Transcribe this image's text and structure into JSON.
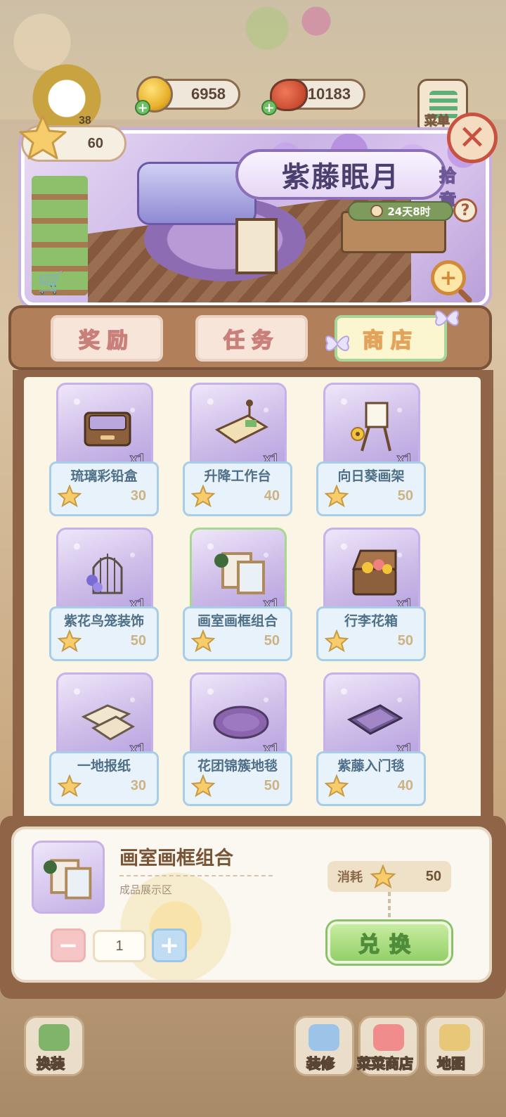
{
  "currency": {
    "coins": "6958",
    "food": "10183",
    "level": "38",
    "menu_label": "菜单"
  },
  "event": {
    "star_count": "60",
    "title": "紫藤眠月",
    "badge": "拾章",
    "timer": "24天8时",
    "help": "?",
    "zoom": "+"
  },
  "tabs": [
    {
      "label": "奖励",
      "active": false
    },
    {
      "label": "任务",
      "active": false
    },
    {
      "label": "商店",
      "active": true
    }
  ],
  "shop_items": [
    {
      "name": "琉璃彩铅盒",
      "qty": "x1",
      "price": "30",
      "icon": "pencil-box-icon"
    },
    {
      "name": "升降工作台",
      "qty": "x1",
      "price": "40",
      "icon": "workbench-icon"
    },
    {
      "name": "向日葵画架",
      "qty": "x1",
      "price": "50",
      "icon": "sunflower-easel-icon"
    },
    {
      "name": "紫花鸟笼装饰",
      "qty": "x1",
      "price": "50",
      "icon": "birdcage-icon"
    },
    {
      "name": "画室画框组合",
      "qty": "x1",
      "price": "50",
      "icon": "picture-frames-icon"
    },
    {
      "name": "行李花箱",
      "qty": "x1",
      "price": "50",
      "icon": "flower-trunk-icon"
    },
    {
      "name": "一地报纸",
      "qty": "x1",
      "price": "30",
      "icon": "newspapers-icon"
    },
    {
      "name": "花团锦簇地毯",
      "qty": "x1",
      "price": "50",
      "icon": "flower-rug-icon"
    },
    {
      "name": "紫藤入门毯",
      "qty": "x1",
      "price": "40",
      "icon": "door-mat-icon"
    }
  ],
  "detail": {
    "title": "画室画框组合",
    "subtitle": "成品展示区",
    "cost_label": "消耗",
    "cost_value": "50",
    "quantity": "1",
    "minus": "−",
    "plus": "+",
    "redeem_label": "兑换"
  },
  "nav": [
    {
      "label": "换装",
      "icon": "wardrobe-icon"
    },
    {
      "label": "装修",
      "icon": "decorate-icon"
    },
    {
      "label": "菜菜商店",
      "icon": "store-icon"
    },
    {
      "label": "地图",
      "icon": "map-icon"
    }
  ],
  "colors": {
    "accent_purple": "#c6b1e8",
    "redeem_green": "#93d06b",
    "frame_brown": "#8f6447"
  }
}
